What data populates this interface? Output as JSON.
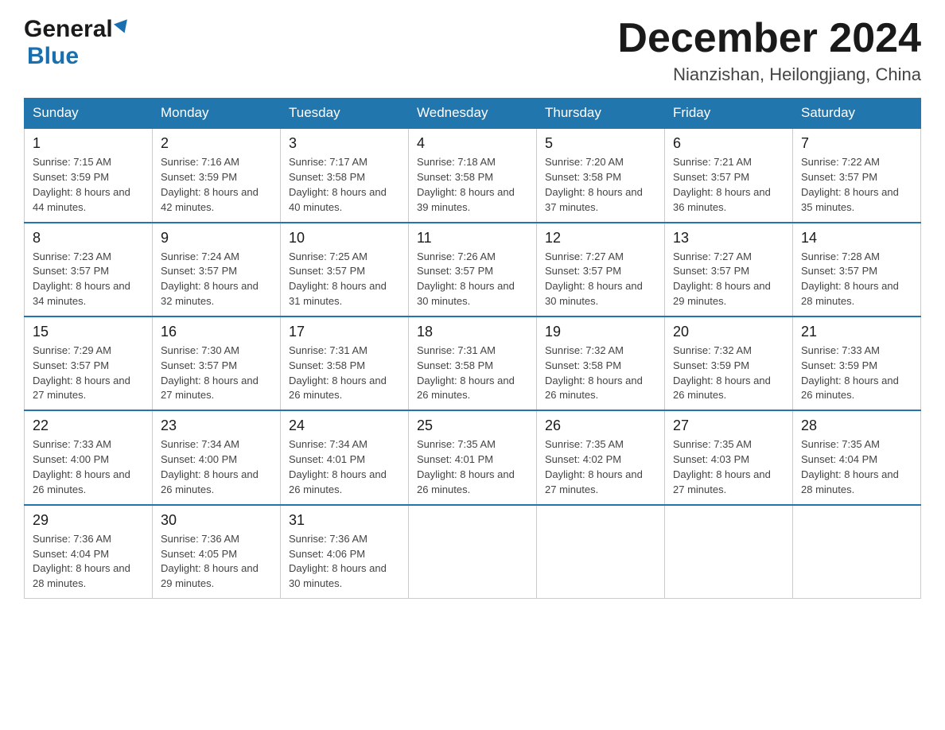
{
  "logo": {
    "general": "General",
    "blue": "Blue",
    "triangle_aria": "blue triangle"
  },
  "header": {
    "month_title": "December 2024",
    "location": "Nianzishan, Heilongjiang, China"
  },
  "days_of_week": [
    "Sunday",
    "Monday",
    "Tuesday",
    "Wednesday",
    "Thursday",
    "Friday",
    "Saturday"
  ],
  "weeks": [
    [
      {
        "day": "1",
        "sunrise": "7:15 AM",
        "sunset": "3:59 PM",
        "daylight": "8 hours and 44 minutes."
      },
      {
        "day": "2",
        "sunrise": "7:16 AM",
        "sunset": "3:59 PM",
        "daylight": "8 hours and 42 minutes."
      },
      {
        "day": "3",
        "sunrise": "7:17 AM",
        "sunset": "3:58 PM",
        "daylight": "8 hours and 40 minutes."
      },
      {
        "day": "4",
        "sunrise": "7:18 AM",
        "sunset": "3:58 PM",
        "daylight": "8 hours and 39 minutes."
      },
      {
        "day": "5",
        "sunrise": "7:20 AM",
        "sunset": "3:58 PM",
        "daylight": "8 hours and 37 minutes."
      },
      {
        "day": "6",
        "sunrise": "7:21 AM",
        "sunset": "3:57 PM",
        "daylight": "8 hours and 36 minutes."
      },
      {
        "day": "7",
        "sunrise": "7:22 AM",
        "sunset": "3:57 PM",
        "daylight": "8 hours and 35 minutes."
      }
    ],
    [
      {
        "day": "8",
        "sunrise": "7:23 AM",
        "sunset": "3:57 PM",
        "daylight": "8 hours and 34 minutes."
      },
      {
        "day": "9",
        "sunrise": "7:24 AM",
        "sunset": "3:57 PM",
        "daylight": "8 hours and 32 minutes."
      },
      {
        "day": "10",
        "sunrise": "7:25 AM",
        "sunset": "3:57 PM",
        "daylight": "8 hours and 31 minutes."
      },
      {
        "day": "11",
        "sunrise": "7:26 AM",
        "sunset": "3:57 PM",
        "daylight": "8 hours and 30 minutes."
      },
      {
        "day": "12",
        "sunrise": "7:27 AM",
        "sunset": "3:57 PM",
        "daylight": "8 hours and 30 minutes."
      },
      {
        "day": "13",
        "sunrise": "7:27 AM",
        "sunset": "3:57 PM",
        "daylight": "8 hours and 29 minutes."
      },
      {
        "day": "14",
        "sunrise": "7:28 AM",
        "sunset": "3:57 PM",
        "daylight": "8 hours and 28 minutes."
      }
    ],
    [
      {
        "day": "15",
        "sunrise": "7:29 AM",
        "sunset": "3:57 PM",
        "daylight": "8 hours and 27 minutes."
      },
      {
        "day": "16",
        "sunrise": "7:30 AM",
        "sunset": "3:57 PM",
        "daylight": "8 hours and 27 minutes."
      },
      {
        "day": "17",
        "sunrise": "7:31 AM",
        "sunset": "3:58 PM",
        "daylight": "8 hours and 26 minutes."
      },
      {
        "day": "18",
        "sunrise": "7:31 AM",
        "sunset": "3:58 PM",
        "daylight": "8 hours and 26 minutes."
      },
      {
        "day": "19",
        "sunrise": "7:32 AM",
        "sunset": "3:58 PM",
        "daylight": "8 hours and 26 minutes."
      },
      {
        "day": "20",
        "sunrise": "7:32 AM",
        "sunset": "3:59 PM",
        "daylight": "8 hours and 26 minutes."
      },
      {
        "day": "21",
        "sunrise": "7:33 AM",
        "sunset": "3:59 PM",
        "daylight": "8 hours and 26 minutes."
      }
    ],
    [
      {
        "day": "22",
        "sunrise": "7:33 AM",
        "sunset": "4:00 PM",
        "daylight": "8 hours and 26 minutes."
      },
      {
        "day": "23",
        "sunrise": "7:34 AM",
        "sunset": "4:00 PM",
        "daylight": "8 hours and 26 minutes."
      },
      {
        "day": "24",
        "sunrise": "7:34 AM",
        "sunset": "4:01 PM",
        "daylight": "8 hours and 26 minutes."
      },
      {
        "day": "25",
        "sunrise": "7:35 AM",
        "sunset": "4:01 PM",
        "daylight": "8 hours and 26 minutes."
      },
      {
        "day": "26",
        "sunrise": "7:35 AM",
        "sunset": "4:02 PM",
        "daylight": "8 hours and 27 minutes."
      },
      {
        "day": "27",
        "sunrise": "7:35 AM",
        "sunset": "4:03 PM",
        "daylight": "8 hours and 27 minutes."
      },
      {
        "day": "28",
        "sunrise": "7:35 AM",
        "sunset": "4:04 PM",
        "daylight": "8 hours and 28 minutes."
      }
    ],
    [
      {
        "day": "29",
        "sunrise": "7:36 AM",
        "sunset": "4:04 PM",
        "daylight": "8 hours and 28 minutes."
      },
      {
        "day": "30",
        "sunrise": "7:36 AM",
        "sunset": "4:05 PM",
        "daylight": "8 hours and 29 minutes."
      },
      {
        "day": "31",
        "sunrise": "7:36 AM",
        "sunset": "4:06 PM",
        "daylight": "8 hours and 30 minutes."
      },
      null,
      null,
      null,
      null
    ]
  ],
  "labels": {
    "sunrise": "Sunrise:",
    "sunset": "Sunset:",
    "daylight": "Daylight:"
  }
}
